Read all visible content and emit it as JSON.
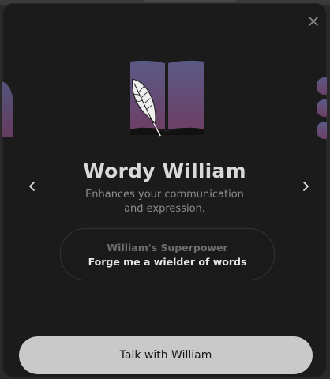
{
  "character": {
    "name": "Wordy William",
    "description": "Enhances your communication and expression.",
    "superpower_label": "William's Superpower",
    "superpower_value": "Forge me a wielder of words"
  },
  "actions": {
    "talk_label": "Talk with William"
  },
  "icons": {
    "close": "close-icon",
    "prev": "chevron-left-icon",
    "next": "chevron-right-icon",
    "hero": "open-book-quill-icon"
  },
  "colors": {
    "modal_bg": "#1b1b1b",
    "title": "#d9d9d9",
    "button_bg": "#c9c9c9",
    "book_top": "#5a5a86",
    "book_bottom": "#6d3f66"
  }
}
